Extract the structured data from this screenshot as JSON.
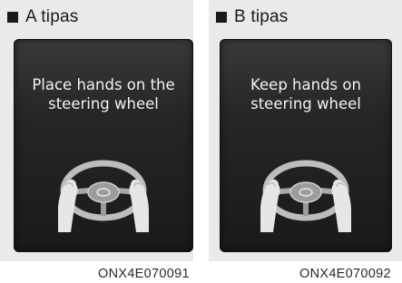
{
  "panels": [
    {
      "title": "A tipas",
      "message": "Place hands on the\nsteering wheel",
      "icon": "steering-wheel-hands-icon",
      "code": "ONX4E070091"
    },
    {
      "title": "B tipas",
      "message": "Keep hands on\nsteering wheel",
      "icon": "steering-wheel-hands-icon",
      "code": "ONX4E070092"
    }
  ],
  "colors": {
    "panel_bg": "#eaeaea",
    "display_bg": "#262626",
    "text_light": "#f2f2f2",
    "text_dark": "#1a1a1a"
  }
}
